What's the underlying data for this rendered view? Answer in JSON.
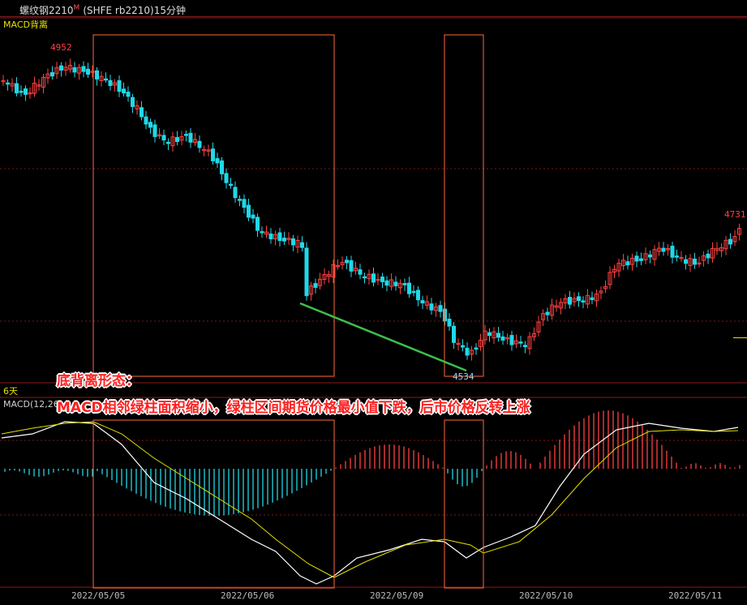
{
  "window": {
    "title_name": "螺纹钢2210",
    "title_marker": "M",
    "title_code": "(SHFE rb2210)15分钟"
  },
  "main_panel": {
    "indicator_label": "MACD背离",
    "high_label": "4952",
    "low_label": "4534",
    "last_label": "4731"
  },
  "sub_panel": {
    "period_label": "6天",
    "indicator_label": "MACD(12,26"
  },
  "annotation": {
    "line1": "底背离形态：",
    "line2": "MACD相邻绿柱面积缩小，绿柱区间期货价格最小值下跌，后市价格反转上涨"
  },
  "x_axis": {
    "dates": [
      "2022/05/05",
      "2022/05/06",
      "2022/05/09",
      "2022/05/10",
      "2022/05/11"
    ]
  },
  "colors": {
    "up": "#ff4040",
    "down": "#20d8e8",
    "frame": "#ff6a3a",
    "divergence_line": "#3cbf4a",
    "dif": "#ffffff",
    "dea": "#e8e000"
  }
}
